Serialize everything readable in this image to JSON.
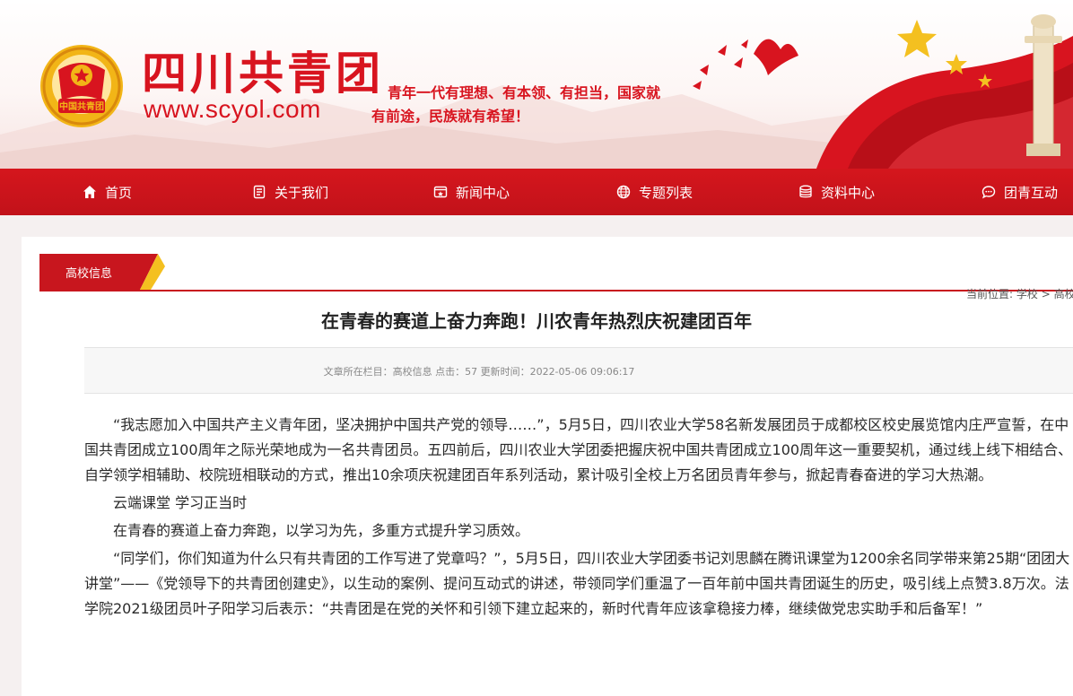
{
  "header": {
    "logo_text": "四川共青团",
    "logo_url": "www.scyol.com",
    "slogan_line1": "青年一代有理想、有本领、有担当，国家就",
    "slogan_line2": "有前途，民族就有希望！",
    "emblem_text": "中国共青团"
  },
  "nav": {
    "items": [
      {
        "label": "首页",
        "icon": "home-icon"
      },
      {
        "label": "关于我们",
        "icon": "document-icon"
      },
      {
        "label": "新闻中心",
        "icon": "news-icon"
      },
      {
        "label": "专题列表",
        "icon": "globe-icon"
      },
      {
        "label": "资料中心",
        "icon": "database-icon"
      },
      {
        "label": "团青互动",
        "icon": "chat-icon"
      }
    ]
  },
  "section": {
    "tab_label": "高校信息",
    "breadcrumb_prefix": "当前位置:",
    "breadcrumb_item1": "学校",
    "breadcrumb_sep": ">",
    "breadcrumb_item2": "高校"
  },
  "article": {
    "title": "在青春的赛道上奋力奔跑！川农青年热烈庆祝建团百年",
    "meta": "文章所在栏目：高校信息 点击：57 更新时间：2022-05-06 09:06:17",
    "paragraphs": [
      "“我志愿加入中国共产主义青年团，坚决拥护中国共产党的领导……”，5月5日，四川农业大学58名新发展团员于成都校区校史展览馆内庄严宣誓，在中国共青团成立100周年之际光荣地成为一名共青团员。五四前后，四川农业大学团委把握庆祝中国共青团成立100周年这一重要契机，通过线上线下相结合、自学领学相辅助、校院班相联动的方式，推出10余项庆祝建团百年系列活动，累计吸引全校上万名团员青年参与，掀起青春奋进的学习大热潮。",
      "云端课堂 学习正当时",
      "在青春的赛道上奋力奔跑，以学习为先，多重方式提升学习质效。",
      "“同学们，你们知道为什么只有共青团的工作写进了党章吗？”，5月5日，四川农业大学团委书记刘思麟在腾讯课堂为1200余名同学带来第25期“团团大讲堂”——《党领导下的共青团创建史》，以生动的案例、提问互动式的讲述，带领同学们重温了一百年前中国共青团诞生的历史，吸引线上点赞3.8万次。法学院2021级团员叶子阳学习后表示：“共青团是在党的关怀和引领下建立起来的，新时代青年应该拿稳接力棒，继续做党忠实助手和后备军！”"
    ]
  },
  "colors": {
    "brand_red": "#d8141f",
    "nav_red": "#c8161e",
    "accent_yellow": "#f4c020"
  }
}
